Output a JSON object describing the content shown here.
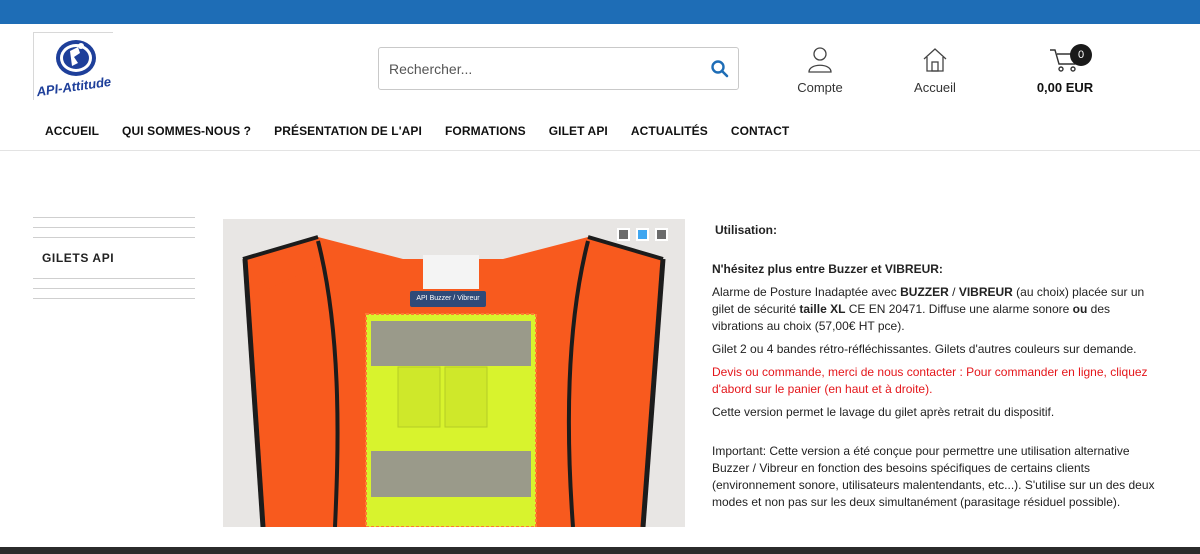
{
  "brand": {
    "logo_text": "API-Attitude",
    "accent_color": "#1e6db6"
  },
  "search": {
    "placeholder": "Rechercher...",
    "icon": "search-icon"
  },
  "header": {
    "account_label": "Compte",
    "home_label": "Accueil",
    "cart_count": "0",
    "cart_total": "0,00 EUR"
  },
  "nav": {
    "items": [
      {
        "label": "ACCUEIL"
      },
      {
        "label": "QUI SOMMES-NOUS ?"
      },
      {
        "label": "PRÉSENTATION DE L'API"
      },
      {
        "label": "FORMATIONS"
      },
      {
        "label": "GILET API"
      },
      {
        "label": "ACTUALITÉS"
      },
      {
        "label": "CONTACT"
      }
    ]
  },
  "sidebar": {
    "title": "GILETS API"
  },
  "gallery": {
    "badge_text": "API Buzzer / Vibreur",
    "slides": 3,
    "active_slide": 2
  },
  "product": {
    "heading": "Utilisation:",
    "subheading": "N'hésitez plus entre Buzzer et VIBREUR:",
    "p1_a": "Alarme de Posture Inadaptée avec ",
    "p1_b": "BUZZER",
    "p1_c": " / ",
    "p1_d": "VIBREUR",
    "p1_e": " (au choix) placée sur un gilet de sécurité ",
    "p1_f": "taille XL",
    "p1_g": " CE EN 20471. Diffuse une alarme sonore ",
    "p1_h": "ou",
    "p1_i": " des vibrations au choix (57,00€ HT pce).",
    "p2": "Gilet 2 ou 4 bandes rétro-réfléchissantes. Gilets d'autres couleurs sur demande.",
    "p3": "Devis ou commande, merci de nous contacter : Pour commander en ligne, cliquez d'abord sur le panier (en haut et à droite).",
    "p4": "Cette version permet le lavage du gilet après retrait du dispositif.",
    "p5": "Important: Cette version a été conçue pour permettre une utilisation alternative Buzzer / Vibreur en fonction des besoins spécifiques de certains clients (environnement sonore, utilisateurs malentendants, etc...). S'utilise sur un des deux modes et non pas sur les deux simultanément (parasitage résiduel possible).",
    "alert_color": "#e4161b"
  }
}
